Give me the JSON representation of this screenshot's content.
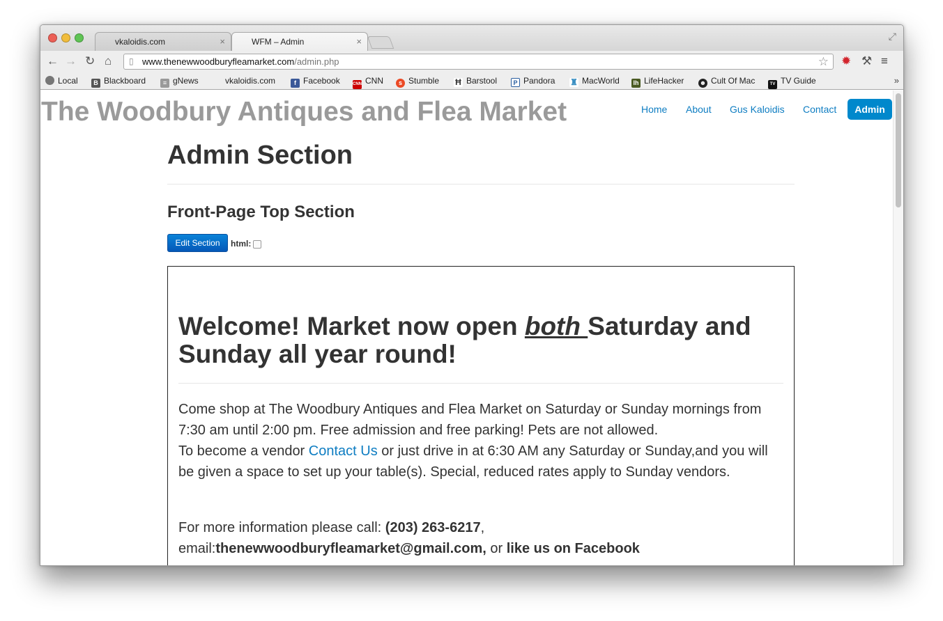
{
  "browser": {
    "tabs": [
      {
        "title": "vkaloidis.com",
        "active": false
      },
      {
        "title": "WFM – Admin",
        "active": true
      }
    ],
    "address": {
      "domain": "www.thenewwoodburyfleamarket.com",
      "path": "/admin.php"
    },
    "bookmarks": [
      {
        "label": "Local",
        "icon": "globe-icon",
        "color": "#777777"
      },
      {
        "label": "Blackboard",
        "icon": "blackboard-icon",
        "color": "#555555"
      },
      {
        "label": "gNews",
        "icon": "news-icon",
        "color": "#888888"
      },
      {
        "label": "vkaloidis.com",
        "icon": "",
        "color": ""
      },
      {
        "label": "Facebook",
        "icon": "facebook-icon",
        "color": "#3b5998"
      },
      {
        "label": "CNN",
        "icon": "cnn-icon",
        "color": "#cc0000"
      },
      {
        "label": "Stumble",
        "icon": "stumbleupon-icon",
        "color": "#eb4924"
      },
      {
        "label": "Barstool",
        "icon": "barstool-icon",
        "color": "#333333"
      },
      {
        "label": "Pandora",
        "icon": "pandora-icon",
        "color": "#2a5ea0"
      },
      {
        "label": "MacWorld",
        "icon": "macworld-icon",
        "color": "#3a8fc2"
      },
      {
        "label": "LifeHacker",
        "icon": "lifehacker-icon",
        "color": "#5a6b2c"
      },
      {
        "label": "Cult Of Mac",
        "icon": "cultofmac-icon",
        "color": "#222222"
      },
      {
        "label": "TV Guide",
        "icon": "tvguide-icon",
        "color": "#111111"
      }
    ]
  },
  "site": {
    "title": "The Woodbury Antiques and Flea Market",
    "nav": {
      "home": "Home",
      "about": "About",
      "gus": "Gus Kaloidis",
      "contact": "Contact",
      "admin": "Admin"
    }
  },
  "admin": {
    "heading": "Admin Section",
    "section_title": "Front-Page Top Section",
    "edit_button": "Edit Section",
    "html_label": "html:",
    "html_checked": false
  },
  "content": {
    "welcome_pre": "Welcome!  Market now open ",
    "welcome_em": "both ",
    "welcome_post": "Saturday and Sunday all year round!",
    "p1_line1": "Come shop at The Woodbury Antiques and Flea Market on Saturday or Sunday mornings  from 7:30 am until 2:00 pm. Free admission and free parking! Pets are not allowed.",
    "p1_vendor_pre": "To become a vendor ",
    "p1_vendor_link": "Contact Us",
    "p1_vendor_post": " or just drive in at 6:30 AM any Saturday or Sunday,and you will be given a space to set up your table(s). Special, reduced rates apply to Sunday vendors.",
    "p2_pre": "For more information please call: ",
    "p2_phone": "(203) 263-6217",
    "p2_comma": ",",
    "p2_email_label": "email:",
    "p2_email": "thenewwoodburyfleamarket@gmail.com,",
    "p2_or": " or ",
    "p2_facebook": "like us on Facebook"
  }
}
